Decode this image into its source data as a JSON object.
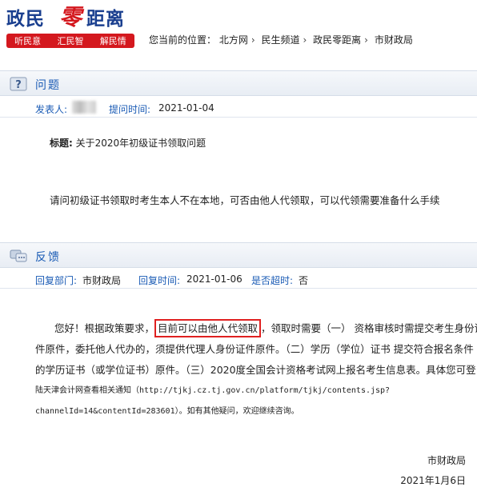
{
  "header": {
    "logo_main_1": "政民",
    "logo_main_2": "零",
    "logo_main_3": "距离",
    "logo_tags": [
      "听民意",
      "汇民智",
      "解民情"
    ],
    "breadcrumb_prefix": "您当前的位置：",
    "breadcrumb": [
      "北方网",
      "民生频道",
      "政民零距离",
      "市财政局"
    ]
  },
  "question": {
    "section_title": "问题",
    "poster_label": "发表人:",
    "time_label": "提问时间:",
    "time_value": "2021-01-04",
    "title_label": "标题:",
    "title_value": "关于2020年初级证书领取问题",
    "body": "请问初级证书领取时考生本人不在本地，可否由他人代领取，可以代领需要准备什么手续"
  },
  "answer": {
    "section_title": "反馈",
    "dept_label": "回复部门:",
    "dept_value": "市财政局",
    "time_label": "回复时间:",
    "time_value": "2021-01-06",
    "overdue_label": "是否超时:",
    "overdue_value": "否",
    "line1_a": "您好！根据政策要求，",
    "line1_highlight": "目前可以由他人代领取",
    "line1_b": "，领取时需要（一）  资格审核时需提交考生身份证",
    "line2": "件原件，委托他人代办的，须提供代理人身份证件原件。（二）学历（学位）证书 提交符合报名条件",
    "line3": "的学历证书（或学位证书）原件。（三）2020度全国会计资格考试网上报名考生信息表。具体您可登",
    "line4": "陆天津会计网查看相关通知（http://tjkj.cz.tj.gov.cn/platform/tjkj/contents.jsp?",
    "line5": "channelId=14&contentId=283601）。如有其他疑问，欢迎继续咨询。",
    "signature": "市财政局",
    "date": "2021年1月6日"
  },
  "colors": {
    "brand_red": "#d4181e",
    "brand_blue": "#1a3f8f",
    "label_blue": "#1a5bb5",
    "highlight": "#e02020"
  }
}
